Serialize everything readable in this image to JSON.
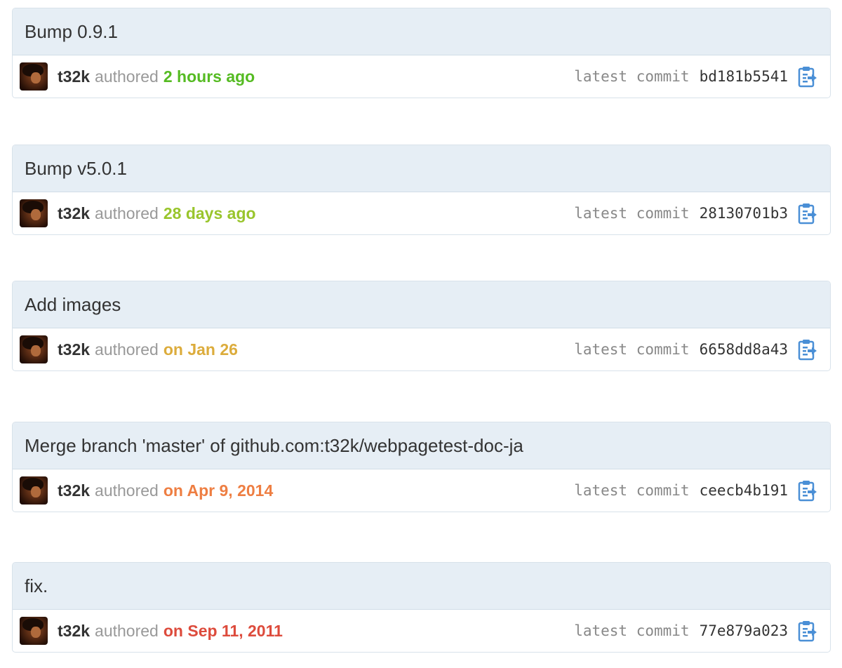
{
  "commits": [
    {
      "message": "Bump 0.9.1",
      "author": "t32k",
      "authored_label": "authored",
      "time": "2 hours ago",
      "time_color": "#55bb22",
      "latest_commit_label": "latest commit",
      "sha": "bd181b5541",
      "icon": "clipboard-icon"
    },
    {
      "message": "Bump v5.0.1",
      "author": "t32k",
      "authored_label": "authored",
      "time": "28 days ago",
      "time_color": "#99c52c",
      "latest_commit_label": "latest commit",
      "sha": "28130701b3",
      "icon": "clipboard-icon"
    },
    {
      "message": "Add images",
      "author": "t32k",
      "authored_label": "authored",
      "time": "on Jan 26",
      "time_color": "#dcac3c",
      "latest_commit_label": "latest commit",
      "sha": "6658dd8a43",
      "icon": "clipboard-icon"
    },
    {
      "message": "Merge branch 'master' of github.com:t32k/webpagetest-doc-ja",
      "author": "t32k",
      "authored_label": "authored",
      "time": "on Apr 9, 2014",
      "time_color": "#ee7e42",
      "latest_commit_label": "latest commit",
      "sha": "ceecb4b191",
      "icon": "clipboard-icon"
    },
    {
      "message": "fix.",
      "author": "t32k",
      "authored_label": "authored",
      "time": "on Sep 11, 2011",
      "time_color": "#dd4b3c",
      "latest_commit_label": "latest commit",
      "sha": "77e879a023",
      "icon": "clipboard-icon"
    }
  ],
  "colors": {
    "title_bar_bg": "#e6eef5",
    "icon_blue": "#4a8fd6"
  }
}
